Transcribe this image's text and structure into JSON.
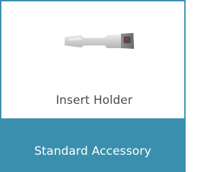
{
  "card": {
    "title": "Insert Holder",
    "category_label": "Standard Accessory",
    "image_icon": "insert-holder-image",
    "colors": {
      "accent": "#3b8fae",
      "title_text": "#4a4a4a",
      "banner_text": "#ffffff",
      "background": "#ffffff"
    }
  }
}
